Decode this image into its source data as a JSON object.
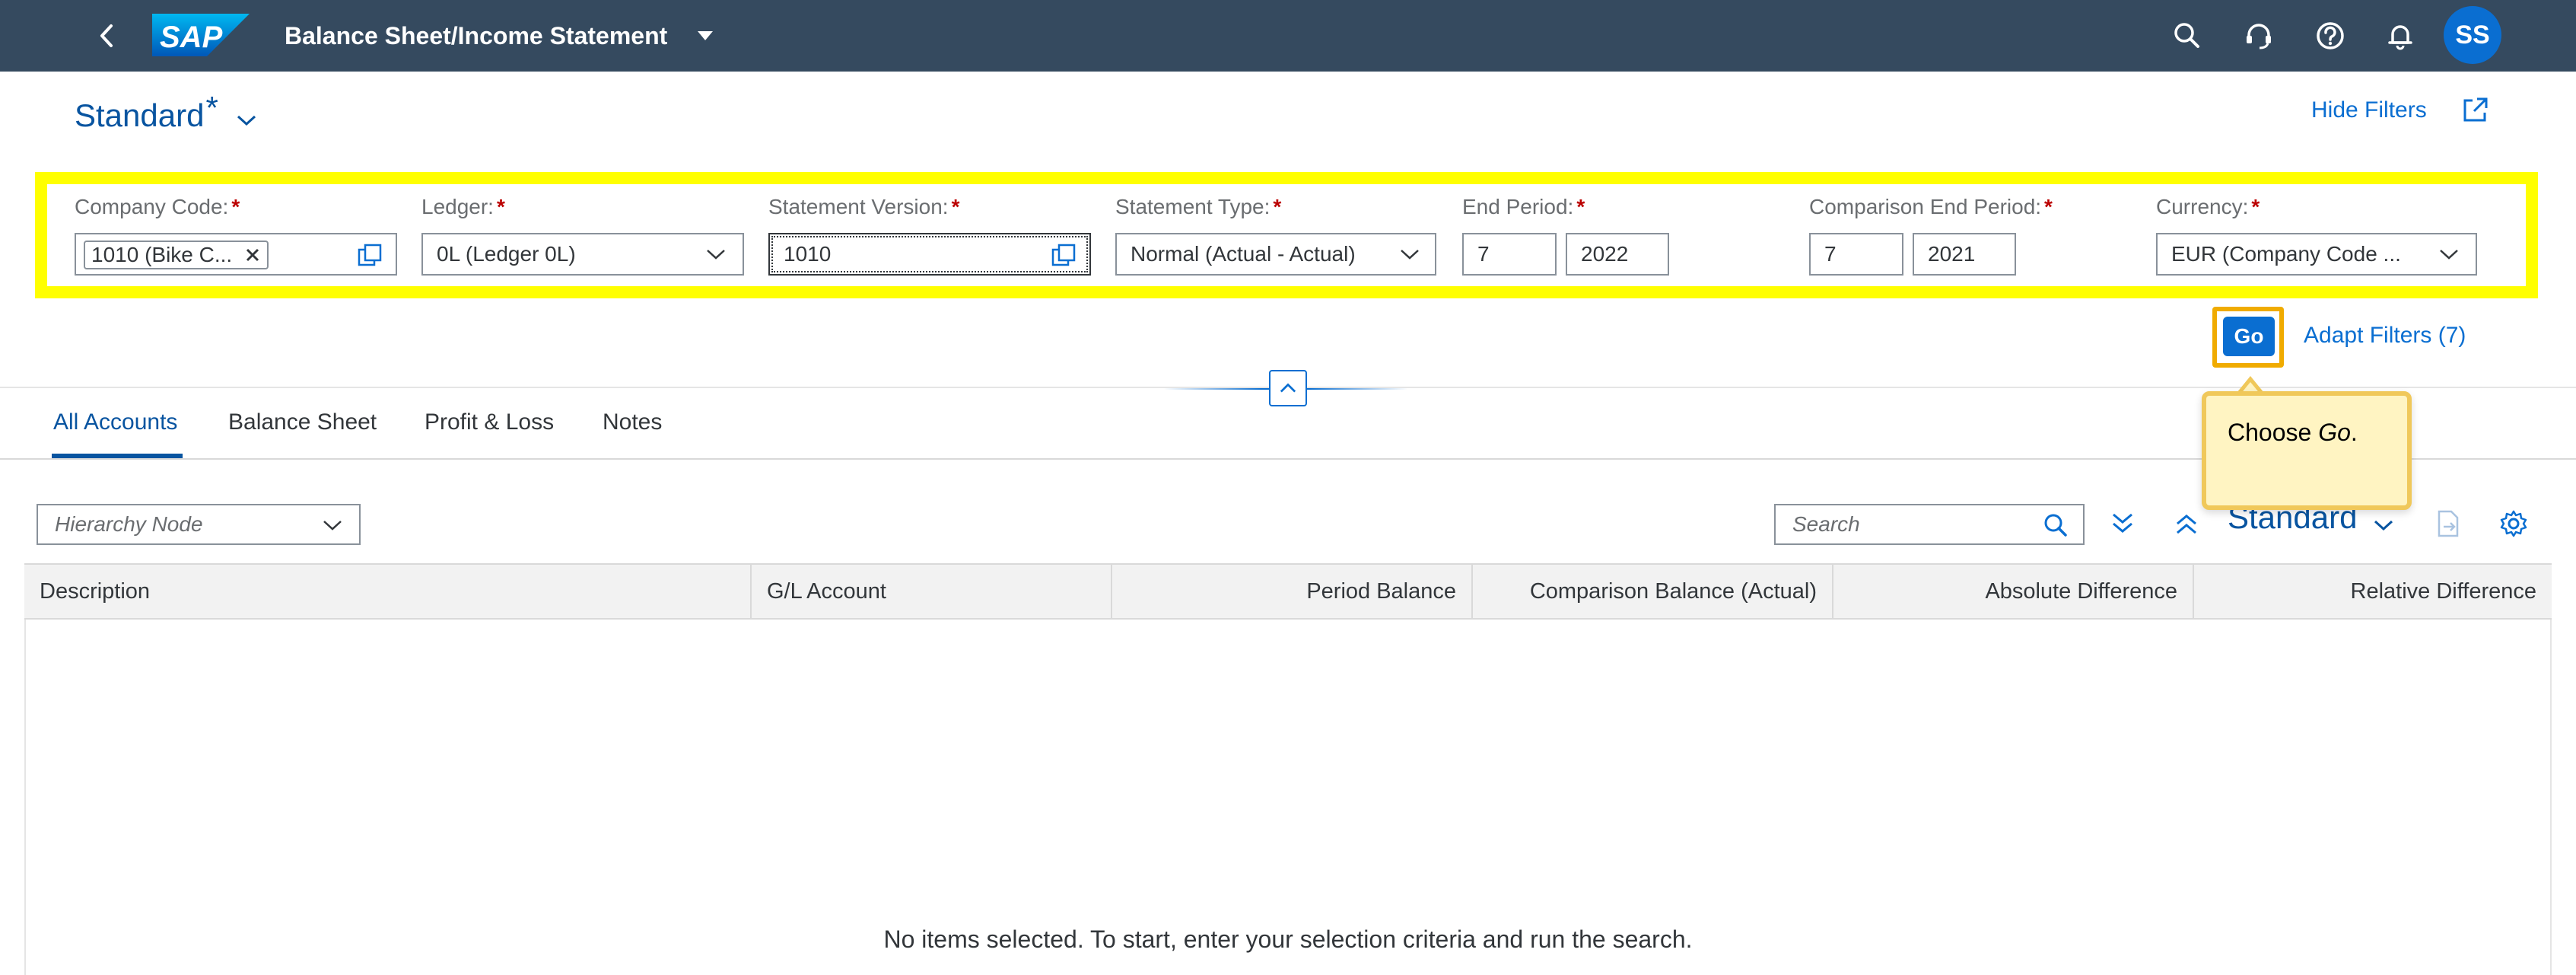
{
  "shell": {
    "app_title": "Balance Sheet/Income Statement",
    "logo_text": "SAP",
    "avatar_initials": "SS",
    "icons": [
      "back-icon",
      "search-icon",
      "headset-icon",
      "help-icon",
      "notification-bell-icon"
    ]
  },
  "variant": {
    "title": "Standard",
    "modified_marker": "*",
    "hide_filters": "Hide Filters"
  },
  "filters": {
    "company_code": {
      "label": "Company Code:",
      "token": "1010 (Bike C..."
    },
    "ledger": {
      "label": "Ledger:",
      "value": "0L (Ledger 0L)"
    },
    "statement_version": {
      "label": "Statement Version:",
      "value": "1010"
    },
    "statement_type": {
      "label": "Statement Type:",
      "value": "Normal (Actual - Actual)"
    },
    "end_period": {
      "label": "End Period:",
      "period": "7",
      "year": "2022"
    },
    "comparison_end_period": {
      "label": "Comparison End Period:",
      "period": "7",
      "year": "2021"
    },
    "currency": {
      "label": "Currency:",
      "value": "EUR (Company Code ..."
    },
    "required_marker": "*"
  },
  "actions": {
    "go": "Go",
    "adapt_filters": "Adapt Filters (7)"
  },
  "callout": {
    "prefix": "Choose ",
    "emphasis": "Go",
    "suffix": "."
  },
  "tabs": [
    {
      "label": "All Accounts",
      "active": true
    },
    {
      "label": "Balance Sheet",
      "active": false
    },
    {
      "label": "Profit & Loss",
      "active": false
    },
    {
      "label": "Notes",
      "active": false
    }
  ],
  "toolbar": {
    "hierarchy_placeholder": "Hierarchy Node",
    "search_placeholder": "Search",
    "variant": "Standard"
  },
  "table": {
    "columns": [
      "Description",
      "G/L Account",
      "Period Balance",
      "Comparison Balance (Actual)",
      "Absolute Difference",
      "Relative Difference"
    ],
    "no_data": "No items selected. To start, enter your selection criteria and run the search."
  },
  "colors": {
    "shell": "#354a5f",
    "brand_blue": "#0a6ed1",
    "highlight_yellow": "#ffff00",
    "callout_bg": "#fff4c2",
    "required": "#bb0000"
  }
}
